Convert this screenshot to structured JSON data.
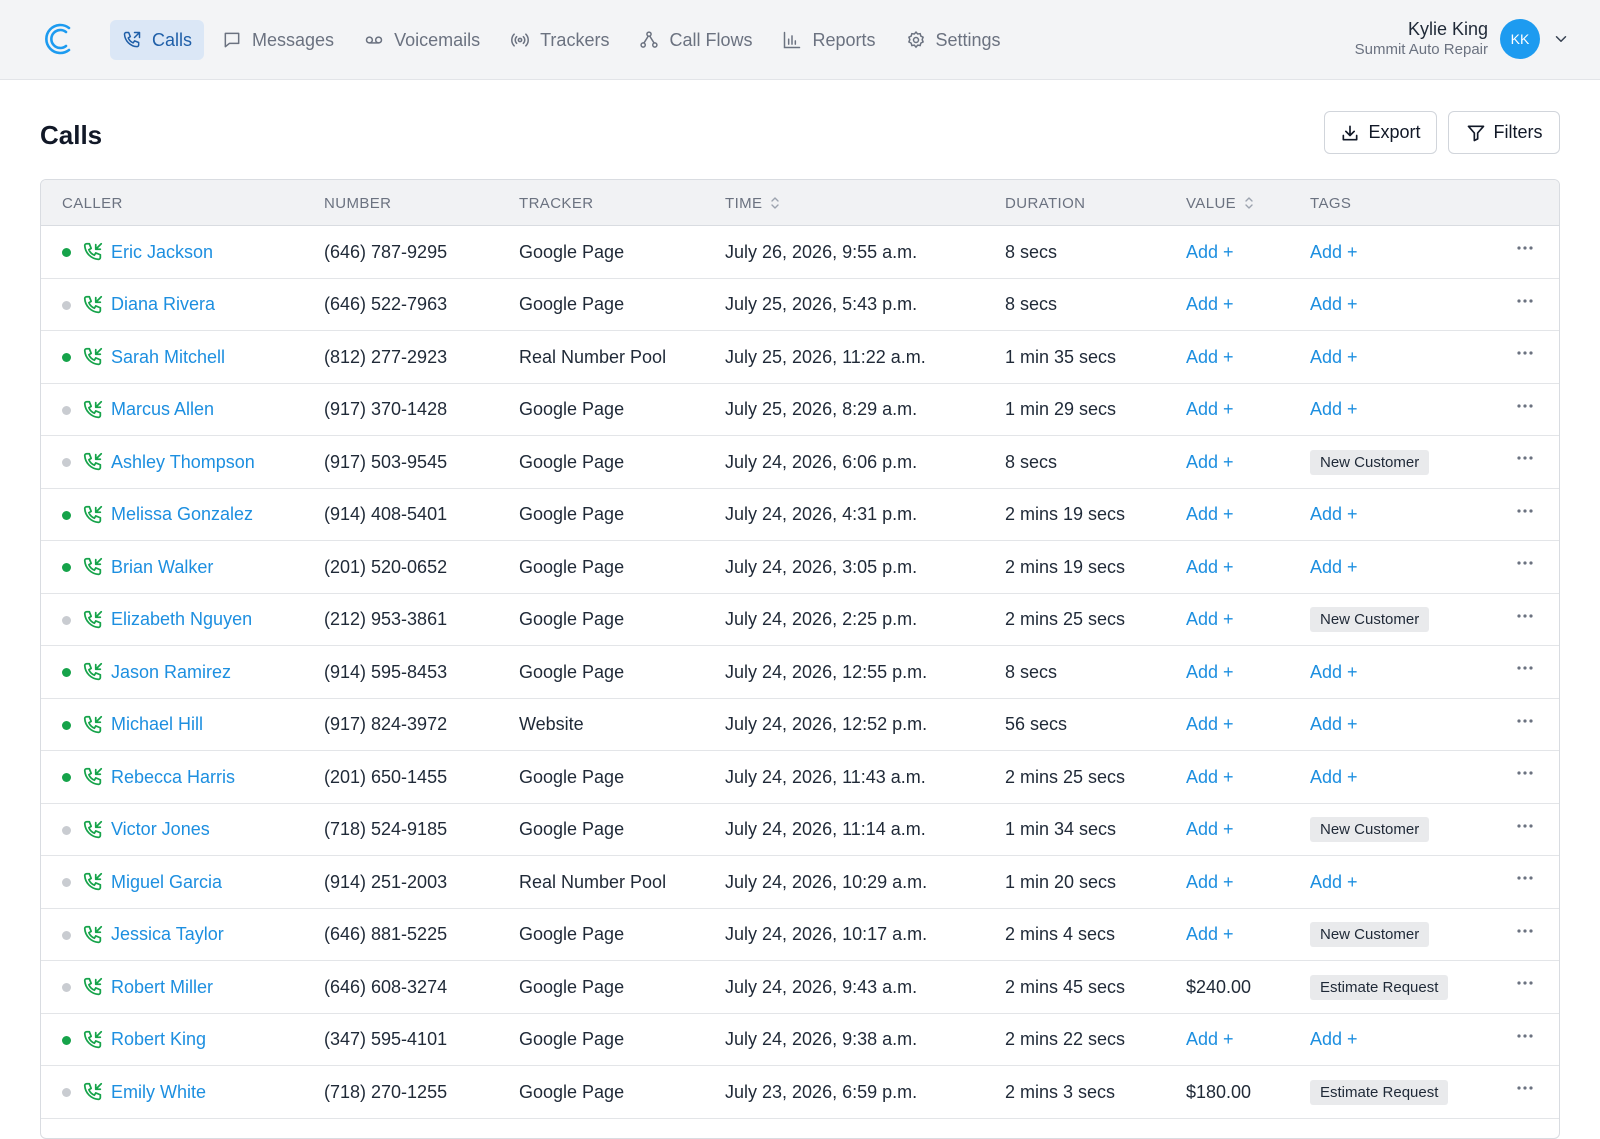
{
  "nav": {
    "items": [
      {
        "label": "Calls",
        "icon": "phone-icon",
        "active": true
      },
      {
        "label": "Messages",
        "icon": "message-icon",
        "active": false
      },
      {
        "label": "Voicemails",
        "icon": "voicemail-icon",
        "active": false
      },
      {
        "label": "Trackers",
        "icon": "broadcast-icon",
        "active": false
      },
      {
        "label": "Call Flows",
        "icon": "flow-icon",
        "active": false
      },
      {
        "label": "Reports",
        "icon": "bar-chart-icon",
        "active": false
      },
      {
        "label": "Settings",
        "icon": "gear-icon",
        "active": false
      }
    ]
  },
  "user": {
    "name": "Kylie King",
    "org": "Summit Auto Repair",
    "initials": "KK"
  },
  "page": {
    "title": "Calls",
    "export_label": "Export",
    "filters_label": "Filters"
  },
  "table": {
    "headers": {
      "caller": "CALLER",
      "number": "NUMBER",
      "tracker": "TRACKER",
      "time": "TIME",
      "duration": "DURATION",
      "value": "VALUE",
      "tags": "TAGS"
    },
    "rows": [
      {
        "status": "green",
        "caller": "Eric Jackson",
        "number": "(646) 787-9295",
        "tracker": "Google Page",
        "time": "July 26, 2026, 9:55 a.m.",
        "duration": "8 secs",
        "value": "Add +",
        "value_is_add": true,
        "tags": "Add +",
        "tags_is_add": true
      },
      {
        "status": "gray",
        "caller": "Diana Rivera",
        "number": "(646) 522-7963",
        "tracker": "Google Page",
        "time": "July 25, 2026, 5:43 p.m.",
        "duration": "8 secs",
        "value": "Add +",
        "value_is_add": true,
        "tags": "Add +",
        "tags_is_add": true
      },
      {
        "status": "green",
        "caller": "Sarah Mitchell",
        "number": "(812) 277-2923",
        "tracker": "Real Number Pool",
        "time": "July 25, 2026, 11:22 a.m.",
        "duration": "1 min 35 secs",
        "value": "Add +",
        "value_is_add": true,
        "tags": "Add +",
        "tags_is_add": true
      },
      {
        "status": "gray",
        "caller": "Marcus Allen",
        "number": "(917) 370-1428",
        "tracker": "Google Page",
        "time": "July 25, 2026, 8:29 a.m.",
        "duration": "1 min 29 secs",
        "value": "Add +",
        "value_is_add": true,
        "tags": "Add +",
        "tags_is_add": true
      },
      {
        "status": "gray",
        "caller": "Ashley Thompson",
        "number": "(917) 503-9545",
        "tracker": "Google Page",
        "time": "July 24, 2026, 6:06 p.m.",
        "duration": "8 secs",
        "value": "Add +",
        "value_is_add": true,
        "tags": "New Customer",
        "tags_is_add": false
      },
      {
        "status": "green",
        "caller": "Melissa Gonzalez",
        "number": "(914) 408-5401",
        "tracker": "Google Page",
        "time": "July 24, 2026, 4:31 p.m.",
        "duration": "2 mins 19 secs",
        "value": "Add +",
        "value_is_add": true,
        "tags": "Add +",
        "tags_is_add": true
      },
      {
        "status": "green",
        "caller": "Brian Walker",
        "number": "(201) 520-0652",
        "tracker": "Google Page",
        "time": "July 24, 2026, 3:05 p.m.",
        "duration": "2 mins 19 secs",
        "value": "Add +",
        "value_is_add": true,
        "tags": "Add +",
        "tags_is_add": true
      },
      {
        "status": "gray",
        "caller": "Elizabeth Nguyen",
        "number": "(212) 953-3861",
        "tracker": "Google Page",
        "time": "July 24, 2026, 2:25 p.m.",
        "duration": "2 mins 25 secs",
        "value": "Add +",
        "value_is_add": true,
        "tags": "New Customer",
        "tags_is_add": false
      },
      {
        "status": "green",
        "caller": "Jason Ramirez",
        "number": "(914) 595-8453",
        "tracker": "Google Page",
        "time": "July 24, 2026, 12:55 p.m.",
        "duration": "8 secs",
        "value": "Add +",
        "value_is_add": true,
        "tags": "Add +",
        "tags_is_add": true
      },
      {
        "status": "green",
        "caller": "Michael Hill",
        "number": "(917) 824-3972",
        "tracker": "Website",
        "time": "July 24, 2026, 12:52 p.m.",
        "duration": "56 secs",
        "value": "Add +",
        "value_is_add": true,
        "tags": "Add +",
        "tags_is_add": true
      },
      {
        "status": "green",
        "caller": "Rebecca Harris",
        "number": "(201) 650-1455",
        "tracker": "Google Page",
        "time": "July 24, 2026, 11:43 a.m.",
        "duration": "2 mins 25 secs",
        "value": "Add +",
        "value_is_add": true,
        "tags": "Add +",
        "tags_is_add": true
      },
      {
        "status": "gray",
        "caller": "Victor Jones",
        "number": "(718) 524-9185",
        "tracker": "Google Page",
        "time": "July 24, 2026, 11:14 a.m.",
        "duration": "1 min 34 secs",
        "value": "Add +",
        "value_is_add": true,
        "tags": "New Customer",
        "tags_is_add": false
      },
      {
        "status": "gray",
        "caller": "Miguel Garcia",
        "number": "(914) 251-2003",
        "tracker": "Real Number Pool",
        "time": "July 24, 2026, 10:29 a.m.",
        "duration": "1 min 20 secs",
        "value": "Add +",
        "value_is_add": true,
        "tags": "Add +",
        "tags_is_add": true
      },
      {
        "status": "gray",
        "caller": "Jessica Taylor",
        "number": "(646) 881-5225",
        "tracker": "Google Page",
        "time": "July 24, 2026, 10:17 a.m.",
        "duration": "2 mins 4 secs",
        "value": "Add +",
        "value_is_add": true,
        "tags": "New Customer",
        "tags_is_add": false
      },
      {
        "status": "gray",
        "caller": "Robert Miller",
        "number": "(646) 608-3274",
        "tracker": "Google Page",
        "time": "July 24, 2026, 9:43 a.m.",
        "duration": "2 mins 45 secs",
        "value": "$240.00",
        "value_is_add": false,
        "tags": "Estimate Request",
        "tags_is_add": false
      },
      {
        "status": "green",
        "caller": "Robert King",
        "number": "(347) 595-4101",
        "tracker": "Google Page",
        "time": "July 24, 2026, 9:38 a.m.",
        "duration": "2 mins 22 secs",
        "value": "Add +",
        "value_is_add": true,
        "tags": "Add +",
        "tags_is_add": true
      },
      {
        "status": "gray",
        "caller": "Emily White",
        "number": "(718) 270-1255",
        "tracker": "Google Page",
        "time": "July 23, 2026, 6:59 p.m.",
        "duration": "2 mins 3 secs",
        "value": "$180.00",
        "value_is_add": false,
        "tags": "Estimate Request",
        "tags_is_add": false
      }
    ]
  },
  "colors": {
    "accent": "#1d8fe0",
    "status_green": "#16a34a",
    "status_gray": "#c9ccd1",
    "icon_green": "#16a34a"
  }
}
